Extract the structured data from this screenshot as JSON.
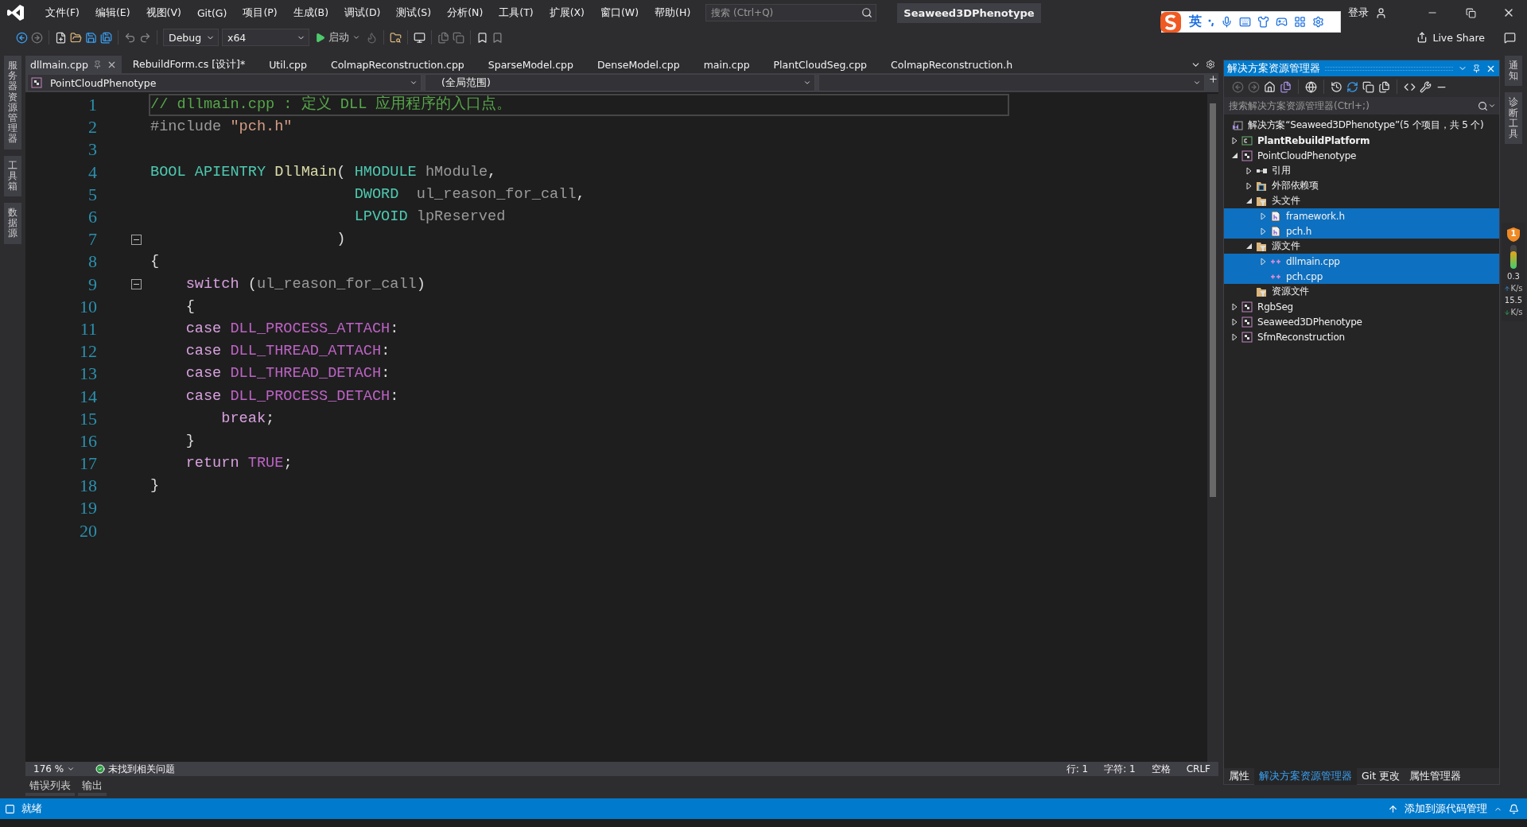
{
  "menu": [
    "文件(F)",
    "编辑(E)",
    "视图(V)",
    "Git(G)",
    "项目(P)",
    "生成(B)",
    "调试(D)",
    "测试(S)",
    "分析(N)",
    "工具(T)",
    "扩展(X)",
    "窗口(W)",
    "帮助(H)"
  ],
  "search": {
    "placeholder": "搜索 (Ctrl+Q)"
  },
  "window": {
    "title": "Seaweed3DPhenotype"
  },
  "ime": {
    "label": "英"
  },
  "account": {
    "label": "登录"
  },
  "live_share": "Live Share",
  "toolbar": {
    "configuration": "Debug",
    "platform": "x64",
    "start": "启动"
  },
  "left_tabs": [
    "服务器资源管理器",
    "工具箱",
    "数据源"
  ],
  "tabs": [
    {
      "label": "dllmain.cpp",
      "selected": true
    },
    {
      "label": "RebuildForm.cs [设计]*",
      "selected": false
    },
    {
      "label": "Util.cpp",
      "selected": false
    },
    {
      "label": "ColmapReconstruction.cpp",
      "selected": false
    },
    {
      "label": "SparseModel.cpp",
      "selected": false
    },
    {
      "label": "DenseModel.cpp",
      "selected": false
    },
    {
      "label": "main.cpp",
      "selected": false
    },
    {
      "label": "PlantCloudSeg.cpp",
      "selected": false
    },
    {
      "label": "ColmapReconstruction.h",
      "selected": false
    }
  ],
  "nav": {
    "project": "PointCloudPhenotype",
    "scope": "(全局范围)"
  },
  "lines": [
    {
      "number": "1",
      "current": true,
      "fold": false,
      "tokens": [
        {
          "kind": "comment",
          "text": "// dllmain.cpp : 定义 DLL 应用程序的入口点。"
        }
      ]
    },
    {
      "number": "2",
      "current": false,
      "fold": false,
      "tokens": [
        {
          "kind": "preproc",
          "text": "#include"
        },
        {
          "kind": "string",
          "text": " \"pch.h\""
        }
      ]
    },
    {
      "number": "3",
      "current": false,
      "fold": false
    },
    {
      "number": "4",
      "current": false,
      "fold": false,
      "tokens": [
        {
          "kind": "type",
          "text": "BOOL"
        },
        {
          "kind": "type",
          "text": " APIENTRY"
        },
        {
          "kind": "func",
          "text": " DllMain"
        },
        {
          "kind": "plain",
          "text": "("
        },
        {
          "kind": "type",
          "text": " HMODULE"
        },
        {
          "kind": "param",
          "text": " hModule"
        },
        {
          "kind": "plain",
          "text": ","
        }
      ]
    },
    {
      "number": "5",
      "current": false,
      "fold": false,
      "tokens": [
        {
          "kind": "type",
          "text": "                       DWORD"
        },
        {
          "kind": "param",
          "text": "  ul_reason_for_call"
        },
        {
          "kind": "plain",
          "text": ","
        }
      ]
    },
    {
      "number": "6",
      "current": false,
      "fold": false,
      "tokens": [
        {
          "kind": "type",
          "text": "                       LPVOID"
        },
        {
          "kind": "param",
          "text": " lpReserved"
        }
      ]
    },
    {
      "number": "7",
      "current": false,
      "fold": true,
      "tokens": [
        {
          "kind": "plain",
          "text": "                     )"
        }
      ]
    },
    {
      "number": "8",
      "current": false,
      "fold": false,
      "tokens": [
        {
          "kind": "plain",
          "text": "{"
        }
      ]
    },
    {
      "number": "9",
      "current": false,
      "fold": true,
      "tokens": [
        {
          "kind": "keyword",
          "text": "    switch"
        },
        {
          "kind": "plain",
          "text": " ("
        },
        {
          "kind": "param",
          "text": "ul_reason_for_call"
        },
        {
          "kind": "plain",
          "text": ")"
        }
      ]
    },
    {
      "number": "10",
      "current": false,
      "fold": false,
      "tokens": [
        {
          "kind": "plain",
          "text": "    {"
        }
      ]
    },
    {
      "number": "11",
      "current": false,
      "fold": false,
      "tokens": [
        {
          "kind": "keyword",
          "text": "    case"
        },
        {
          "kind": "macro",
          "text": " DLL_PROCESS_ATTACH"
        },
        {
          "kind": "plain",
          "text": ":"
        }
      ]
    },
    {
      "number": "12",
      "current": false,
      "fold": false,
      "tokens": [
        {
          "kind": "keyword",
          "text": "    case"
        },
        {
          "kind": "macro",
          "text": " DLL_THREAD_ATTACH"
        },
        {
          "kind": "plain",
          "text": ":"
        }
      ]
    },
    {
      "number": "13",
      "current": false,
      "fold": false,
      "tokens": [
        {
          "kind": "keyword",
          "text": "    case"
        },
        {
          "kind": "macro",
          "text": " DLL_THREAD_DETACH"
        },
        {
          "kind": "plain",
          "text": ":"
        }
      ]
    },
    {
      "number": "14",
      "current": false,
      "fold": false,
      "tokens": [
        {
          "kind": "keyword",
          "text": "    case"
        },
        {
          "kind": "macro",
          "text": " DLL_PROCESS_DETACH"
        },
        {
          "kind": "plain",
          "text": ":"
        }
      ]
    },
    {
      "number": "15",
      "current": false,
      "fold": false,
      "tokens": [
        {
          "kind": "keyword",
          "text": "        break"
        },
        {
          "kind": "plain",
          "text": ";"
        }
      ]
    },
    {
      "number": "16",
      "current": false,
      "fold": false,
      "tokens": [
        {
          "kind": "plain",
          "text": "    }"
        }
      ]
    },
    {
      "number": "17",
      "current": false,
      "fold": false,
      "tokens": [
        {
          "kind": "keyword",
          "text": "    return"
        },
        {
          "kind": "macro",
          "text": " TRUE"
        },
        {
          "kind": "plain",
          "text": ";"
        }
      ]
    },
    {
      "number": "18",
      "current": false,
      "fold": false,
      "tokens": [
        {
          "kind": "plain",
          "text": "}"
        }
      ]
    },
    {
      "number": "19",
      "current": false,
      "fold": false
    },
    {
      "number": "20",
      "current": false,
      "fold": false
    }
  ],
  "editor_status": {
    "zoom": "176 %",
    "issues": "未找到相关问题",
    "line": "行: 1",
    "char": "字符: 1",
    "indent": "空格",
    "eol": "CRLF"
  },
  "bottom_tabs": [
    "错误列表",
    "输出"
  ],
  "explorer": {
    "title": "解决方案资源管理器",
    "search_placeholder": "搜索解决方案资源管理器(Ctrl+;)",
    "solution": "解决方案“Seaweed3DPhenotype”(5 个项目，共 5 个)",
    "projects": [
      {
        "label": "PlantRebuildPlatform",
        "kind": "csharp",
        "startup": true,
        "expanded": false,
        "selected": false
      },
      {
        "label": "PointCloudPhenotype",
        "kind": "cpp",
        "startup": false,
        "expanded": true,
        "selected": false,
        "children": [
          {
            "label": "引用",
            "kind": "references",
            "expanded": false,
            "selected": false
          },
          {
            "label": "外部依赖项",
            "kind": "external",
            "expanded": false,
            "selected": false
          },
          {
            "label": "头文件",
            "kind": "filter",
            "expanded": true,
            "selected": false,
            "children": [
              {
                "label": "framework.h",
                "kind": "header",
                "expanded": false,
                "selected": true
              },
              {
                "label": "pch.h",
                "kind": "header",
                "expanded": false,
                "selected": true
              }
            ]
          },
          {
            "label": "源文件",
            "kind": "filter",
            "expanded": true,
            "selected": false,
            "children": [
              {
                "label": "dllmain.cpp",
                "kind": "source",
                "expanded": false,
                "selected": true
              },
              {
                "label": "pch.cpp",
                "kind": "source",
                "selected": true
              }
            ]
          },
          {
            "label": "资源文件",
            "kind": "filter",
            "selected": false
          }
        ]
      },
      {
        "label": "RgbSeg",
        "kind": "cpp",
        "startup": false,
        "expanded": false,
        "selected": false
      },
      {
        "label": "Seaweed3DPhenotype",
        "kind": "cpp",
        "startup": false,
        "expanded": false,
        "selected": false
      },
      {
        "label": "SfmReconstruction",
        "kind": "cpp",
        "startup": false,
        "expanded": false,
        "selected": false
      }
    ],
    "tabs": [
      {
        "label": "属性",
        "selected": false
      },
      {
        "label": "解决方案资源管理器",
        "selected": true
      },
      {
        "label": "Git 更改",
        "selected": false
      },
      {
        "label": "属性管理器",
        "selected": false
      }
    ]
  },
  "right_tabs": [
    "通知",
    "诊断工具"
  ],
  "monitor": {
    "alerts": "1",
    "level": 0.75,
    "upload": "0.3",
    "upload_unit": "K/s",
    "download": "15.5",
    "download_unit": "K/s"
  },
  "status_bar": {
    "state": "就绪",
    "source_control": "添加到源代码管理"
  }
}
